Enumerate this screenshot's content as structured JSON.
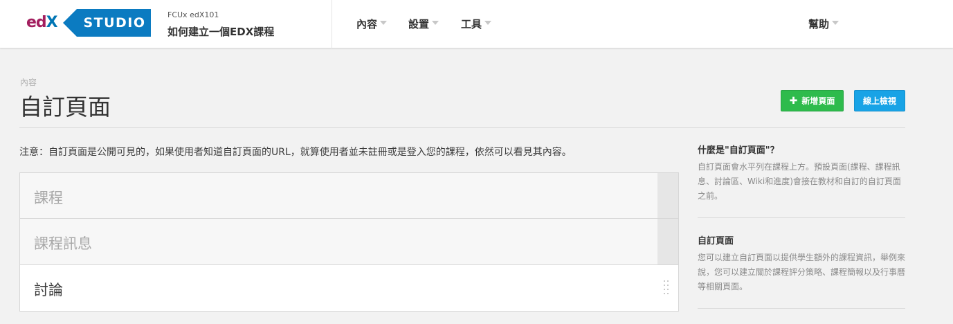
{
  "header": {
    "logo_text": "edX",
    "studio_label": "STUDIO",
    "course_id": "FCUx edX101",
    "course_name": "如何建立一個EDX課程",
    "nav": [
      {
        "label": "內容"
      },
      {
        "label": "設置"
      },
      {
        "label": "工具"
      }
    ],
    "help_label": "幫助",
    "colors": {
      "brand_magenta": "#a31f5f",
      "brand_blue": "#0075b4",
      "studio_blue": "#0b7bc1"
    }
  },
  "page": {
    "breadcrumb": "內容",
    "title": "自訂頁面",
    "actions": {
      "new_page": {
        "icon": "plus-icon",
        "label": "新增頁面",
        "color": "#2ebb4c"
      },
      "view_live": {
        "label": "線上檢視",
        "color": "#18a3e6"
      }
    },
    "note": "注意：自訂頁面是公開可見的，如果使用者知道自訂頁面的URL，就算使用者並未註冊或是登入您的課程，依然可以看見其內容。",
    "tabs": [
      {
        "label": "課程"
      },
      {
        "label": "課程訊息"
      },
      {
        "label": "討論"
      }
    ]
  },
  "sidebar": {
    "blocks": [
      {
        "title": "什麼是\"自訂頁面\"？",
        "text": "自訂頁面會水平列在課程上方。預設頁面(課程、課程訊息、討論區、Wiki和進度)會接在教材和自訂的自訂頁面之前。"
      },
      {
        "title": "自訂頁面",
        "text": "您可以建立自訂頁面以提供學生額外的課程資訊，舉例來說，您可以建立關於課程評分策略、課程簡報以及行事曆等相關頁面。"
      }
    ]
  }
}
